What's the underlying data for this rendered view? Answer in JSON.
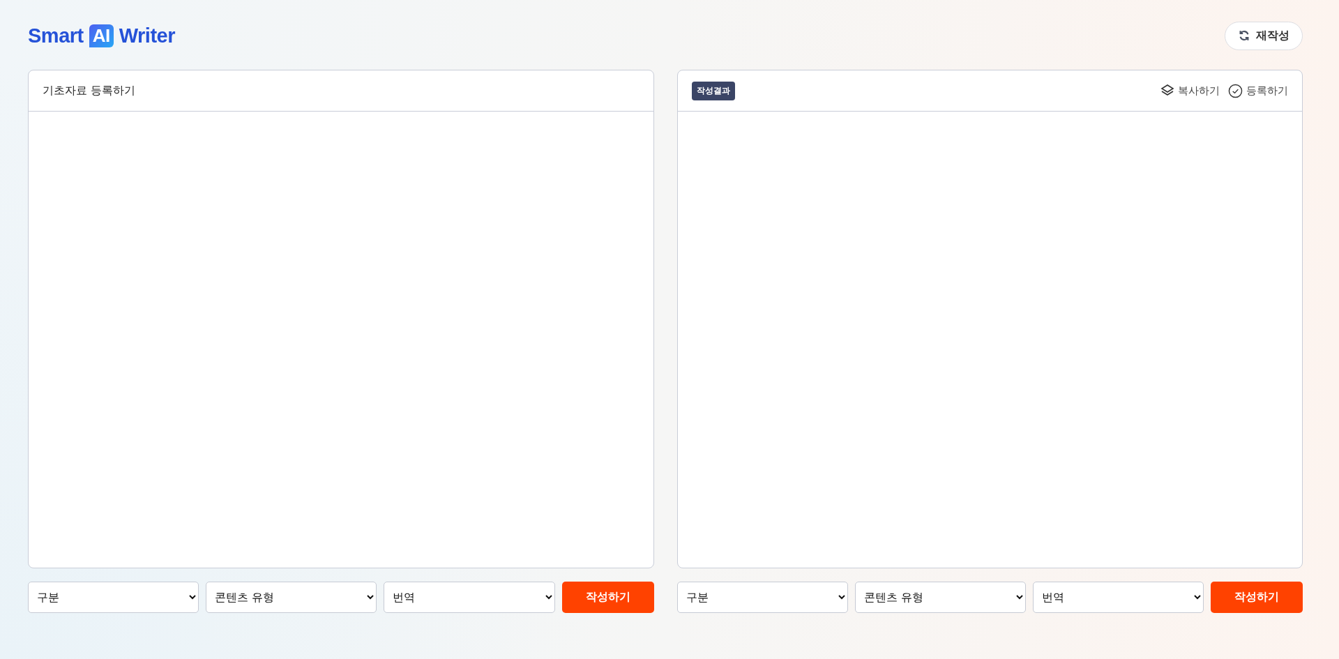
{
  "header": {
    "logo": {
      "before": "Smart",
      "badge": "AI",
      "after": "Writer"
    },
    "rewrite_button": "재작성"
  },
  "panels": [
    {
      "kind": "input",
      "title": "기초자료 등록하기",
      "controls": {
        "dropdowns": [
          "구분",
          "콘텐츠 유형",
          "번역"
        ],
        "submit": "작성하기"
      }
    },
    {
      "kind": "output",
      "badge": "작성결과",
      "actions": [
        {
          "kind": "copy",
          "label": "복사하기"
        },
        {
          "kind": "register",
          "label": "등록하기"
        }
      ],
      "controls": {
        "dropdowns": [
          "구분",
          "콘텐츠 유형",
          "번역"
        ],
        "submit": "작성하기"
      }
    }
  ]
}
